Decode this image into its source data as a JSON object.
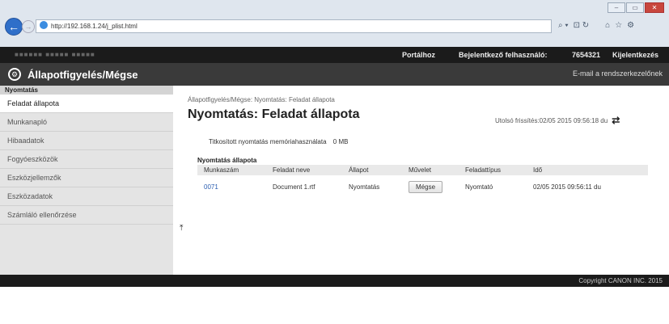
{
  "browser": {
    "url": "http://192.168.1.24/j_plist.html",
    "window_buttons": [
      "–",
      "▭",
      "✕"
    ],
    "tools": [
      "⌕ ▾",
      "⊡ ↻",
      "⌂",
      "☆",
      "⚙"
    ]
  },
  "topbar": {
    "blurred_device": "■■■■■■    ■■■■■ ■■■■■",
    "portal_link": "Portálhoz",
    "login_label": "Bejelentkező felhasználó:",
    "login_user": "7654321",
    "logout_link": "Kijelentkezés"
  },
  "header": {
    "title": "Állapotfigyelés/Mégse",
    "email_link": "E-mail a rendszerkezelőnek"
  },
  "sidebar": {
    "section": "Nyomtatás",
    "items": [
      {
        "label": "Feladat állapota",
        "active": true
      },
      {
        "label": "Munkanapló",
        "active": false
      },
      {
        "label": "Hibaadatok",
        "active": false
      },
      {
        "label": "Fogyóeszközök",
        "active": false
      },
      {
        "label": "Eszközjellemzők",
        "active": false
      },
      {
        "label": "Eszközadatok",
        "active": false
      },
      {
        "label": "Számláló ellenőrzése",
        "active": false
      }
    ]
  },
  "main": {
    "breadcrumb": "Állapotfigyelés/Mégse: Nyomtatás: Feladat állapota",
    "title": "Nyomtatás: Feladat állapota",
    "last_updated": "Utolsó frissítés:02/05 2015 09:56:18 du",
    "memory_label": "Titkosított nyomtatás memóriahasználata",
    "memory_value": "0 MB",
    "section_title": "Nyomtatás állapota",
    "columns": [
      "Munkaszám",
      "Feladat neve",
      "Állapot",
      "Művelet",
      "Feladattípus",
      "Idő"
    ],
    "rows": [
      {
        "id": "0071",
        "name": "Document 1.rtf",
        "status": "Nyomtatás",
        "action": "Mégse",
        "type": "Nyomtató",
        "time": "02/05 2015 09:56:11 du"
      }
    ]
  },
  "footer": {
    "copyright": "Copyright CANON INC. 2015"
  }
}
